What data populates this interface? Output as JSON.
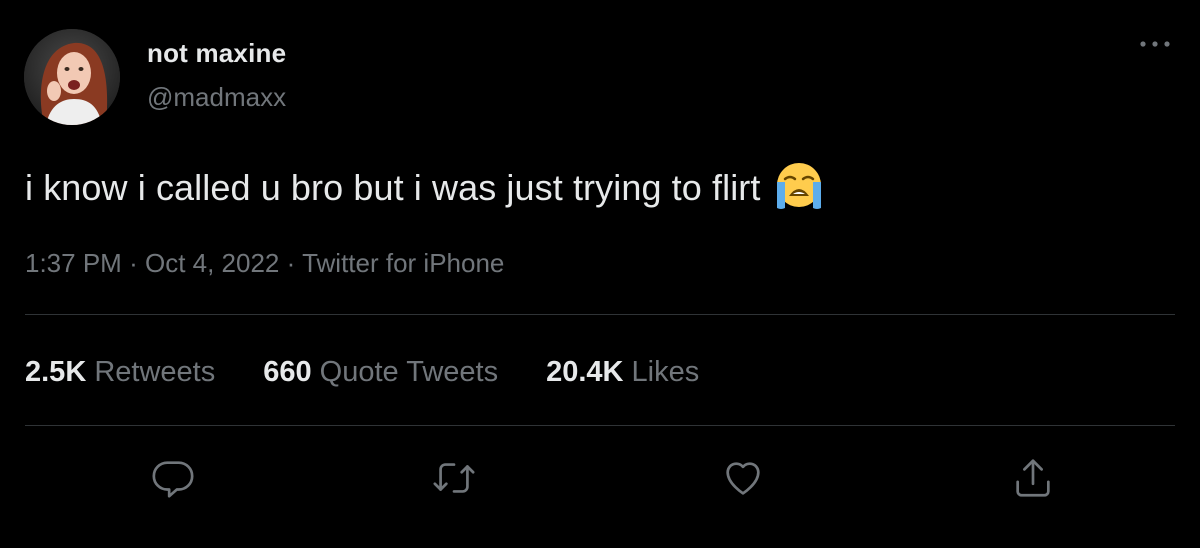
{
  "colors": {
    "background": "#000000",
    "primary_text": "#e7e9ea",
    "secondary_text": "#71767b",
    "divider": "#2f3336",
    "icon": "#71767b"
  },
  "author": {
    "display_name": "not maxine",
    "handle": "@madmaxx",
    "avatar_icon": "profile-photo"
  },
  "tweet": {
    "text": "i know i called u bro but i was just trying to flirt",
    "emoji_icon": "loudly-crying-face-icon",
    "time": "1:37 PM",
    "separator": "·",
    "date": "Oct 4, 2022",
    "source": "Twitter for iPhone"
  },
  "stats": [
    {
      "value": "2.5K",
      "label": "Retweets"
    },
    {
      "value": "660",
      "label": "Quote Tweets"
    },
    {
      "value": "20.4K",
      "label": "Likes"
    }
  ],
  "actions": [
    {
      "icon": "reply-icon"
    },
    {
      "icon": "retweet-icon"
    },
    {
      "icon": "like-heart-icon"
    },
    {
      "icon": "share-icon"
    }
  ],
  "menu": {
    "icon": "more-options-icon"
  }
}
